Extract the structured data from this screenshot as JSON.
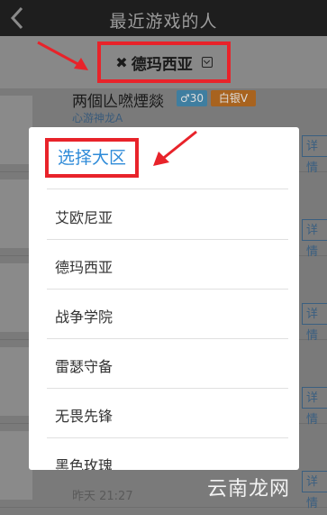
{
  "header": {
    "title": "最近游戏的人"
  },
  "region_selector": {
    "name": "德玛西亚",
    "close_symbol": "✖"
  },
  "list": [
    {
      "name": "两個亾嘫煙燚",
      "age": "♂30",
      "level": "白银V",
      "sub": "心游神龙A",
      "detail": "详情",
      "time": ""
    },
    {
      "name": "",
      "age": "",
      "level": "",
      "sub": "",
      "detail": "详情",
      "time": ""
    },
    {
      "name": "",
      "age": "",
      "level": "",
      "sub": "",
      "detail": "详情",
      "time": ""
    },
    {
      "name": "",
      "age": "",
      "level": "",
      "sub": "",
      "detail": "详情",
      "time": ""
    },
    {
      "name": "",
      "age": "",
      "level": "",
      "sub": "",
      "detail": "详情",
      "time": "昨天 21:27"
    }
  ],
  "popup": {
    "title": "选择大区",
    "options": [
      "艾欧尼亚",
      "德玛西亚",
      "战争学院",
      "雷瑟守备",
      "无畏先锋",
      "黑色玫瑰"
    ]
  },
  "watermark": "云南龙网",
  "colors": {
    "accent_red": "#e8232a",
    "popup_title": "#2f8bd8"
  }
}
